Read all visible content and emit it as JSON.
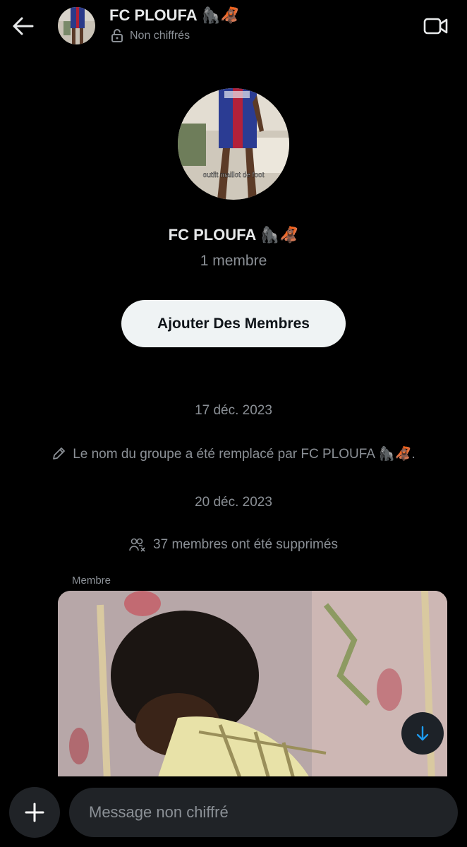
{
  "header": {
    "title": "FC PLOUFA 🦍🦧",
    "encryption_status": "Non chiffrés"
  },
  "group": {
    "name": "FC PLOUFA 🦍🦧",
    "members": "1 membre",
    "avatar_caption": "outfit maillot de foot",
    "add_members_label": "Ajouter Des Membres"
  },
  "timeline": {
    "date1": "17 déc. 2023",
    "rename_event": "Le nom du groupe a été remplacé par FC PLOUFA 🦍🦧.",
    "date2": "20 déc. 2023",
    "removed_event": "37 membres ont été supprimés",
    "sender": "Membre"
  },
  "composer": {
    "placeholder": "Message non chiffré"
  },
  "colors": {
    "background": "#000000",
    "text_primary": "#e7e9ea",
    "text_secondary": "#8b9096",
    "button_light": "#eff3f4",
    "input_bg": "#202327",
    "accent_blue": "#1d9bf0"
  }
}
